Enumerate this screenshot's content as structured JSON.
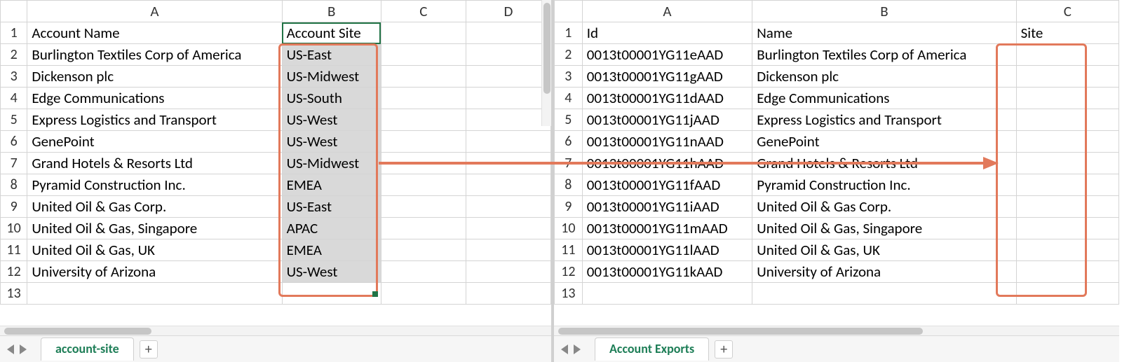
{
  "left": {
    "columns": [
      "A",
      "B",
      "C",
      "D"
    ],
    "headers": {
      "A": "Account Name",
      "B": "Account Site"
    },
    "rows": [
      {
        "n": "1"
      },
      {
        "n": "2",
        "A": "Burlington Textiles Corp of America",
        "B": "US-East"
      },
      {
        "n": "3",
        "A": "Dickenson plc",
        "B": "US-Midwest"
      },
      {
        "n": "4",
        "A": "Edge Communications",
        "B": "US-South"
      },
      {
        "n": "5",
        "A": "Express Logistics and Transport",
        "B": "US-West"
      },
      {
        "n": "6",
        "A": "GenePoint",
        "B": "US-West"
      },
      {
        "n": "7",
        "A": "Grand Hotels & Resorts Ltd",
        "B": "US-Midwest"
      },
      {
        "n": "8",
        "A": "Pyramid Construction Inc.",
        "B": "EMEA"
      },
      {
        "n": "9",
        "A": "United Oil & Gas Corp.",
        "B": "US-East"
      },
      {
        "n": "10",
        "A": "United Oil & Gas, Singapore",
        "B": "APAC"
      },
      {
        "n": "11",
        "A": "United Oil & Gas, UK",
        "B": "EMEA"
      },
      {
        "n": "12",
        "A": "University of Arizona",
        "B": "US-West"
      },
      {
        "n": "13"
      }
    ],
    "sheet_tab": "account-site",
    "add_label": "+"
  },
  "right": {
    "columns": [
      "A",
      "B",
      "C"
    ],
    "headers": {
      "A": "Id",
      "B": "Name",
      "C": "Site"
    },
    "rows": [
      {
        "n": "1"
      },
      {
        "n": "2",
        "A": "0013t00001YG11eAAD",
        "B": "Burlington Textiles Corp of America"
      },
      {
        "n": "3",
        "A": "0013t00001YG11gAAD",
        "B": "Dickenson plc"
      },
      {
        "n": "4",
        "A": "0013t00001YG11dAAD",
        "B": "Edge Communications"
      },
      {
        "n": "5",
        "A": "0013t00001YG11jAAD",
        "B": "Express Logistics and Transport"
      },
      {
        "n": "6",
        "A": "0013t00001YG11nAAD",
        "B": "GenePoint"
      },
      {
        "n": "7",
        "A": "0013t00001YG11hAAD",
        "B": "Grand Hotels & Resorts Ltd"
      },
      {
        "n": "8",
        "A": "0013t00001YG11fAAD",
        "B": "Pyramid Construction Inc."
      },
      {
        "n": "9",
        "A": "0013t00001YG11iAAD",
        "B": "United Oil & Gas Corp."
      },
      {
        "n": "10",
        "A": "0013t00001YG11mAAD",
        "B": "United Oil & Gas, Singapore"
      },
      {
        "n": "11",
        "A": "0013t00001YG11lAAD",
        "B": "United Oil & Gas, UK"
      },
      {
        "n": "12",
        "A": "0013t00001YG11kAAD",
        "B": "University of Arizona"
      },
      {
        "n": "13"
      }
    ],
    "sheet_tab": "Account Exports",
    "add_label": "+"
  },
  "colors": {
    "highlight": "#e2795b",
    "excel_green": "#217346",
    "tab_green": "#1e7e57"
  }
}
